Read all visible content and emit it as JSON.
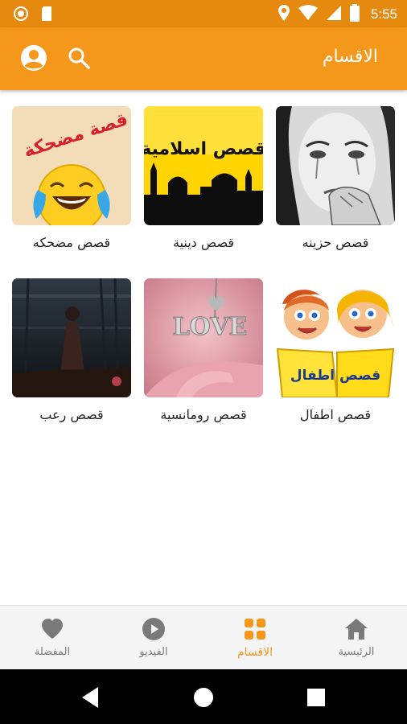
{
  "status_bar": {
    "time": "5:55",
    "icons": [
      "notification-circle-icon",
      "sd-card-icon",
      "location-icon",
      "wifi-icon",
      "signal-icon",
      "battery-icon"
    ]
  },
  "app_bar": {
    "title": "الاقسام",
    "actions": [
      "account-icon",
      "search-icon"
    ]
  },
  "categories": [
    {
      "label": "قصص حزينه",
      "thumb_text": ""
    },
    {
      "label": "قصص دينية",
      "thumb_text": "قصص اسلامية"
    },
    {
      "label": "قصص مضحكه",
      "thumb_text": "قصة مضحكة"
    },
    {
      "label": "قصص اطفال",
      "thumb_text": "قصص اطفال"
    },
    {
      "label": "قصص رومانسية",
      "thumb_text": "LOVE"
    },
    {
      "label": "قصص رعب",
      "thumb_text": ""
    }
  ],
  "bottom_nav": {
    "active": "categories",
    "items": [
      {
        "key": "home",
        "label": "الرئيسية",
        "icon": "home-icon"
      },
      {
        "key": "categories",
        "label": "الاقسام",
        "icon": "grid-icon"
      },
      {
        "key": "video",
        "label": "الفيديو",
        "icon": "play-icon"
      },
      {
        "key": "favorites",
        "label": "المفضلة",
        "icon": "heart-icon"
      }
    ]
  },
  "colors": {
    "status_bar": "#e6890f",
    "app_bar": "#f5971a",
    "accent": "#f5971a",
    "nav_inactive": "#7a7a7a"
  }
}
